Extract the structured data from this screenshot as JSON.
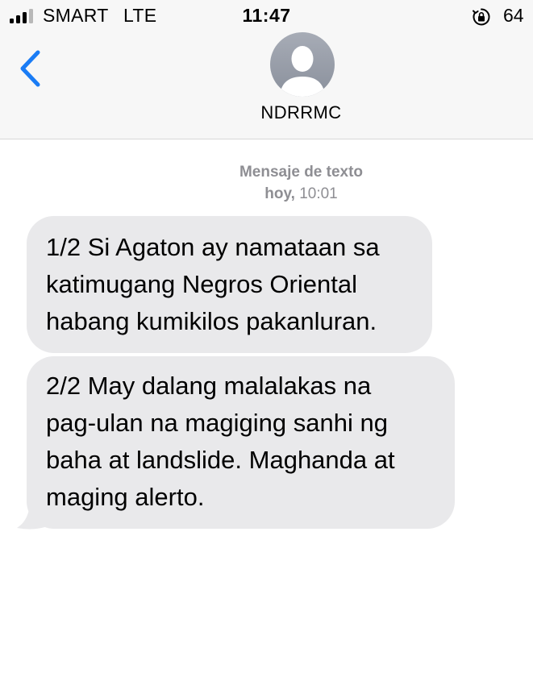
{
  "status_bar": {
    "carrier": "SMART",
    "network": "LTE",
    "time": "11:47",
    "battery": "64",
    "icons": [
      "signal-bars-icon",
      "orientation-lock-icon"
    ]
  },
  "nav": {
    "back_icon": "chevron-left-icon",
    "avatar_icon": "person-silhouette-icon",
    "contact_name": "NDRRMC"
  },
  "thread": {
    "message_type": "Mensaje de texto",
    "day": "hoy,",
    "time": "10:01"
  },
  "messages": [
    {
      "lines": [
        "1/2 Si Agaton ay namataan sa",
        "katimugang Negros Oriental",
        "habang kumikilos pakanluran."
      ]
    },
    {
      "lines": [
        "2/2 May dalang malalakas na",
        "pag-ulan na magiging sanhi ng",
        "baha at landslide. Maghanda at",
        "maging alerto."
      ]
    }
  ],
  "colors": {
    "header_bg": "#f7f7f7",
    "accent": "#1a7cf5",
    "bubble_bg": "#e9e9eb",
    "meta_text": "#8e8e93"
  }
}
